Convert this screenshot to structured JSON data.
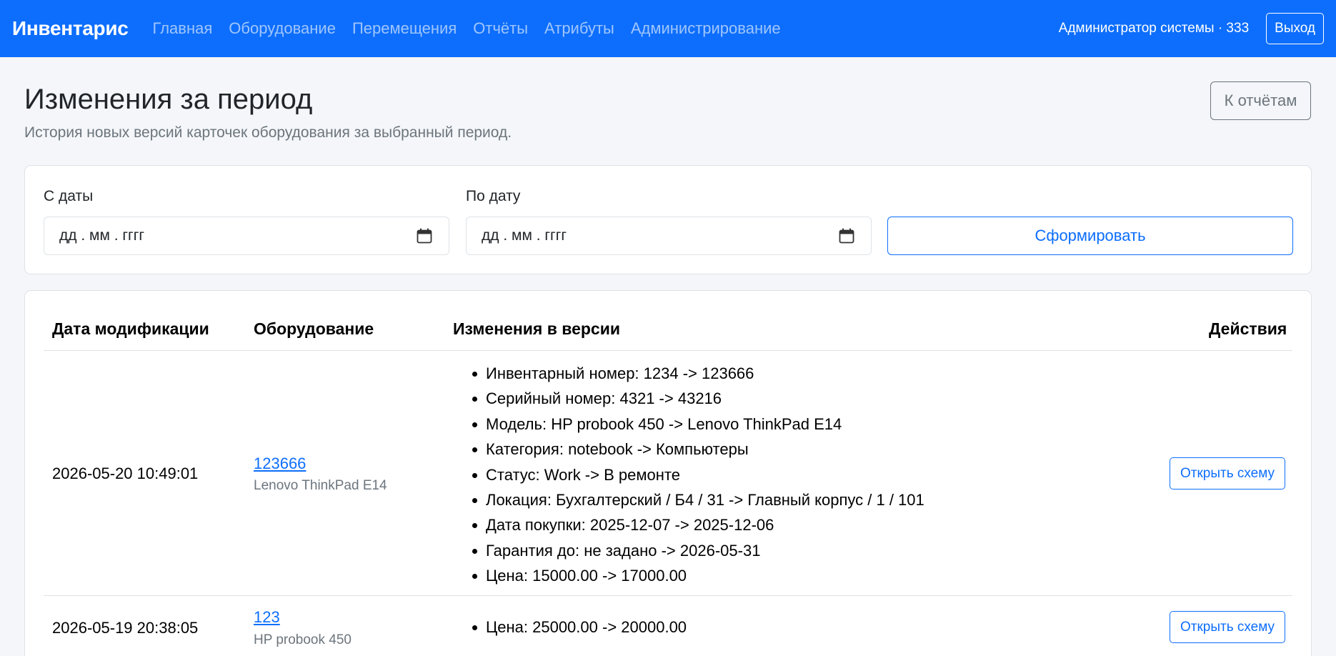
{
  "nav": {
    "brand": "Инвентарис",
    "links": [
      "Главная",
      "Оборудование",
      "Перемещения",
      "Отчёты",
      "Атрибуты",
      "Администрирование"
    ],
    "user": "Администратор системы · 333",
    "logout": "Выход"
  },
  "header": {
    "title": "Изменения за период",
    "subtitle": "История новых версий карточек оборудования за выбранный период.",
    "back_button": "К отчётам"
  },
  "filter": {
    "from_label": "С даты",
    "from_value": "дд . мм . гггг",
    "to_label": "По дату",
    "to_value": "дд . мм . гггг",
    "submit": "Сформировать"
  },
  "table": {
    "columns": [
      "Дата модификации",
      "Оборудование",
      "Изменения в версии",
      "Действия"
    ],
    "rows": [
      {
        "date": "2026-05-20 10:49:01",
        "equipment_id": "123666",
        "equipment_model": "Lenovo ThinkPad E14",
        "changes": [
          "Инвентарный номер: 1234 -> 123666",
          "Серийный номер: 4321 -> 43216",
          "Модель: HP probook 450 -> Lenovo ThinkPad E14",
          "Категория: notebook -> Компьютеры",
          "Статус: Work -> В ремонте",
          "Локация: Бухгалтерский / Б4 / 31 -> Главный корпус / 1 / 101",
          "Дата покупки: 2025-12-07 -> 2025-12-06",
          "Гарантия до: не задано -> 2026-05-31",
          "Цена: 15000.00 -> 17000.00"
        ],
        "action": "Открыть схему"
      },
      {
        "date": "2026-05-19 20:38:05",
        "equipment_id": "123",
        "equipment_model": "HP probook 450",
        "changes": [
          "Цена: 25000.00 -> 20000.00"
        ],
        "action": "Открыть схему"
      }
    ]
  },
  "icons": {
    "calendar": "calendar-icon"
  },
  "colors": {
    "primary": "#0d6efd",
    "secondary": "#6c757d",
    "background": "#f4f6f9"
  }
}
